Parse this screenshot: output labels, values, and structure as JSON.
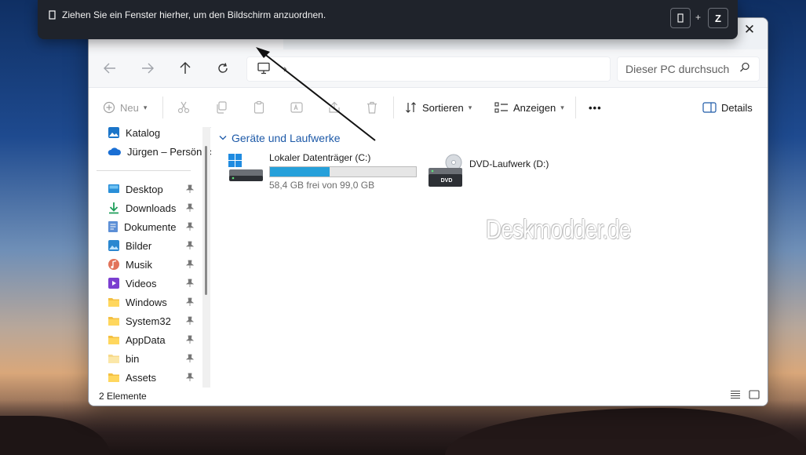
{
  "toast": {
    "message": "Ziehen Sie ein Fenster hierher, um den Bildschirm anzuordnen.",
    "key_plus": "+",
    "key_z": "Z"
  },
  "window": {
    "close_glyph": "✕"
  },
  "address": {
    "chevron": "›",
    "search_placeholder": "Dieser PC durchsuch"
  },
  "toolbar": {
    "new_label": "Neu",
    "sort_label": "Sortieren",
    "view_label": "Anzeigen",
    "more_label": "•••",
    "details_label": "Details"
  },
  "sidebar": {
    "items": [
      {
        "label": "Katalog",
        "icon": "gallery-icon"
      },
      {
        "label": "Jürgen – Persönlic",
        "icon": "onedrive-icon"
      },
      {
        "label": "Desktop",
        "icon": "desktop-icon",
        "pinned": true
      },
      {
        "label": "Downloads",
        "icon": "download-icon",
        "pinned": true
      },
      {
        "label": "Dokumente",
        "icon": "documents-icon",
        "pinned": true
      },
      {
        "label": "Bilder",
        "icon": "pictures-icon",
        "pinned": true
      },
      {
        "label": "Musik",
        "icon": "music-icon",
        "pinned": true
      },
      {
        "label": "Videos",
        "icon": "videos-icon",
        "pinned": true
      },
      {
        "label": "Windows",
        "icon": "folder-icon",
        "pinned": true
      },
      {
        "label": "System32",
        "icon": "folder-icon",
        "pinned": true
      },
      {
        "label": "AppData",
        "icon": "folder-icon",
        "pinned": true
      },
      {
        "label": "bin",
        "icon": "folder-icon",
        "pinned": true
      },
      {
        "label": "Assets",
        "icon": "folder-icon",
        "pinned": true
      }
    ]
  },
  "main": {
    "group_title": "Geräte und Laufwerke",
    "drives": [
      {
        "name": "Lokaler Datenträger (C:)",
        "free_text": "58,4 GB frei von 99,0 GB",
        "used_fraction": 0.41
      },
      {
        "name": "DVD-Laufwerk (D:)",
        "badge": "DVD"
      }
    ],
    "watermark": "Deskmodder.de"
  },
  "status": {
    "count": "2 Elemente"
  },
  "colors": {
    "accent": "#26a0da",
    "group_title": "#1e5aa8",
    "toast_bg": "#1f232b"
  }
}
